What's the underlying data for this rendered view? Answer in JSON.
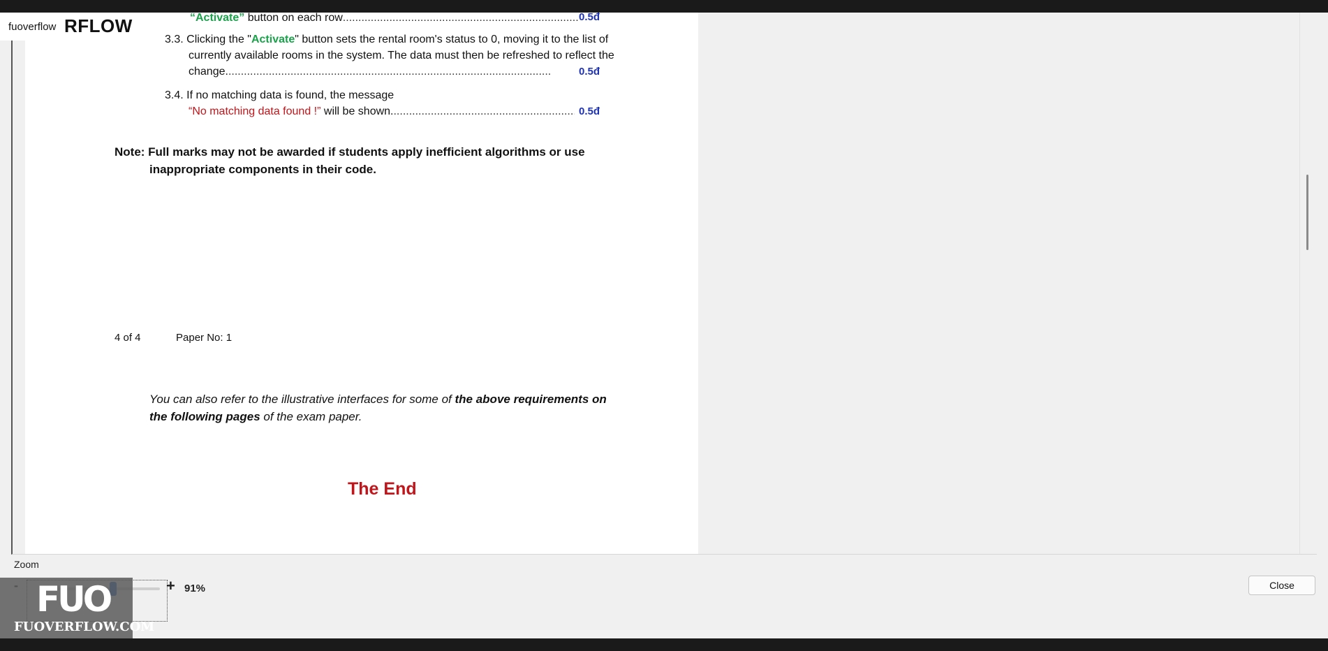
{
  "logo": {
    "small": "fuoverflow",
    "big": "RFLOW"
  },
  "doc": {
    "line_activate_row": {
      "green": "“Activate”",
      "text": " button on each row",
      "dots": "...........................................................................................",
      "score": "0.5đ"
    },
    "item_3_3": {
      "num": "3.3.",
      "part1": " Clicking the \"",
      "green": "Activate",
      "part2": "\" button sets the rental room's status to 0, moving it to the list of",
      "line2": "currently available rooms in the system. The data must then be refreshed to reflect the",
      "line3": "change.",
      "dots": "........................................................................................................",
      "score": "0.5đ"
    },
    "item_3_4": {
      "num": "3.4.",
      "text": " If no matching data is found, the message",
      "red": "“No matching data found !”",
      "text2": " will be shown.",
      "dots": "...............................................................",
      "score": "0.5đ"
    },
    "note": {
      "line1": "Note: Full marks may not be awarded if students apply inefficient algorithms or use",
      "line2": "inappropriate components in their code."
    },
    "footer": {
      "page": "4 of 4",
      "paper": "Paper No: 1"
    },
    "refer": {
      "part1": "You can also refer to the illustrative interfaces for some of ",
      "bold1": "the above requirements on",
      "bold2": "the following pages",
      "part2": " of the exam paper."
    },
    "the_end": "The End"
  },
  "zoom": {
    "label": "Zoom",
    "minus": "-",
    "plus": "+",
    "percent": "91%"
  },
  "watermark": {
    "logo": "FUO",
    "site": "FUOVERFLOW.COM"
  },
  "close_label": "Close"
}
